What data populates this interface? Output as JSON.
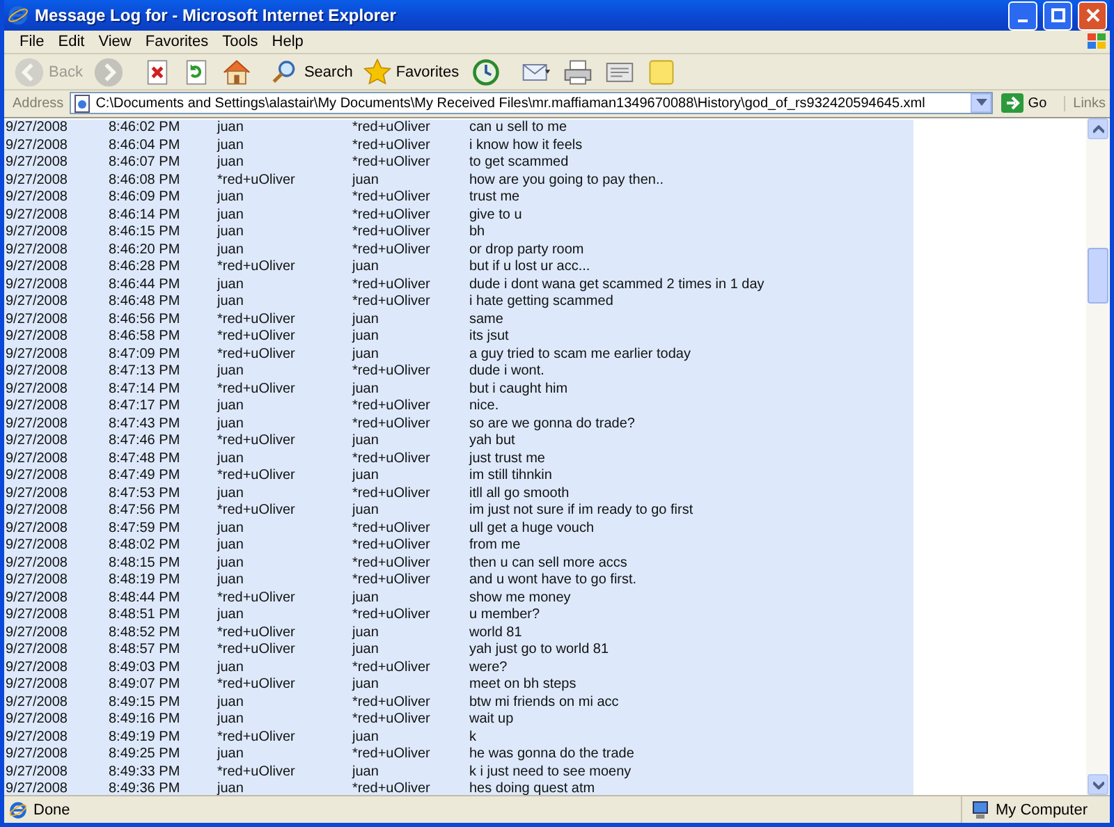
{
  "window": {
    "title": "Message Log for - Microsoft Internet Explorer"
  },
  "menu": [
    "File",
    "Edit",
    "View",
    "Favorites",
    "Tools",
    "Help"
  ],
  "toolbar": [
    {
      "kind": "back",
      "label": "Back",
      "disabled": true
    },
    {
      "kind": "forward",
      "disabled": true
    },
    {
      "kind": "stop",
      "disabled": false
    },
    {
      "kind": "refresh",
      "disabled": false
    },
    {
      "kind": "home",
      "disabled": false
    },
    {
      "kind": "search",
      "label": "Search",
      "disabled": false
    },
    {
      "kind": "favorites",
      "label": "Favorites",
      "disabled": false
    },
    {
      "kind": "history",
      "disabled": false
    },
    {
      "kind": "mail",
      "disabled": false
    },
    {
      "kind": "print",
      "disabled": false
    },
    {
      "kind": "edit",
      "disabled": false
    },
    {
      "kind": "note",
      "disabled": false
    }
  ],
  "address": {
    "label": "Address",
    "value": "C:\\Documents and Settings\\alastair\\My Documents\\My Received Files\\mr.maffiaman1349670088\\History\\god_of_rs932420594645.xml",
    "go": "Go",
    "links": "Links"
  },
  "log": [
    {
      "date": "9/27/2008",
      "time": "8:46:02 PM",
      "from": "juan",
      "to": "*red+uOliver",
      "message": "can u sell to me"
    },
    {
      "date": "9/27/2008",
      "time": "8:46:04 PM",
      "from": "juan",
      "to": "*red+uOliver",
      "message": "i know how it feels"
    },
    {
      "date": "9/27/2008",
      "time": "8:46:07 PM",
      "from": "juan",
      "to": "*red+uOliver",
      "message": "to get scammed"
    },
    {
      "date": "9/27/2008",
      "time": "8:46:08 PM",
      "from": "*red+uOliver",
      "to": "juan",
      "message": "how are you going to pay then.."
    },
    {
      "date": "9/27/2008",
      "time": "8:46:09 PM",
      "from": "juan",
      "to": "*red+uOliver",
      "message": "trust me"
    },
    {
      "date": "9/27/2008",
      "time": "8:46:14 PM",
      "from": "juan",
      "to": "*red+uOliver",
      "message": "give to u"
    },
    {
      "date": "9/27/2008",
      "time": "8:46:15 PM",
      "from": "juan",
      "to": "*red+uOliver",
      "message": "bh"
    },
    {
      "date": "9/27/2008",
      "time": "8:46:20 PM",
      "from": "juan",
      "to": "*red+uOliver",
      "message": "or drop party room"
    },
    {
      "date": "9/27/2008",
      "time": "8:46:28 PM",
      "from": "*red+uOliver",
      "to": "juan",
      "message": "but if u lost ur acc..."
    },
    {
      "date": "9/27/2008",
      "time": "8:46:44 PM",
      "from": "juan",
      "to": "*red+uOliver",
      "message": "dude i dont wana get scammed 2 times in 1 day"
    },
    {
      "date": "9/27/2008",
      "time": "8:46:48 PM",
      "from": "juan",
      "to": "*red+uOliver",
      "message": "i hate getting scammed"
    },
    {
      "date": "9/27/2008",
      "time": "8:46:56 PM",
      "from": "*red+uOliver",
      "to": "juan",
      "message": "same"
    },
    {
      "date": "9/27/2008",
      "time": "8:46:58 PM",
      "from": "*red+uOliver",
      "to": "juan",
      "message": "its jsut"
    },
    {
      "date": "9/27/2008",
      "time": "8:47:09 PM",
      "from": "*red+uOliver",
      "to": "juan",
      "message": "a guy tried to scam me earlier today"
    },
    {
      "date": "9/27/2008",
      "time": "8:47:13 PM",
      "from": "juan",
      "to": "*red+uOliver",
      "message": "dude i wont."
    },
    {
      "date": "9/27/2008",
      "time": "8:47:14 PM",
      "from": "*red+uOliver",
      "to": "juan",
      "message": "but i caught him"
    },
    {
      "date": "9/27/2008",
      "time": "8:47:17 PM",
      "from": "juan",
      "to": "*red+uOliver",
      "message": "nice."
    },
    {
      "date": "9/27/2008",
      "time": "8:47:43 PM",
      "from": "juan",
      "to": "*red+uOliver",
      "message": "so are we gonna do trade?"
    },
    {
      "date": "9/27/2008",
      "time": "8:47:46 PM",
      "from": "*red+uOliver",
      "to": "juan",
      "message": "yah but"
    },
    {
      "date": "9/27/2008",
      "time": "8:47:48 PM",
      "from": "juan",
      "to": "*red+uOliver",
      "message": "just trust me"
    },
    {
      "date": "9/27/2008",
      "time": "8:47:49 PM",
      "from": "*red+uOliver",
      "to": "juan",
      "message": "im still tihnkin"
    },
    {
      "date": "9/27/2008",
      "time": "8:47:53 PM",
      "from": "juan",
      "to": "*red+uOliver",
      "message": "itll all go smooth"
    },
    {
      "date": "9/27/2008",
      "time": "8:47:56 PM",
      "from": "*red+uOliver",
      "to": "juan",
      "message": "im just not sure if im ready to go first"
    },
    {
      "date": "9/27/2008",
      "time": "8:47:59 PM",
      "from": "juan",
      "to": "*red+uOliver",
      "message": "ull get a huge vouch"
    },
    {
      "date": "9/27/2008",
      "time": "8:48:02 PM",
      "from": "juan",
      "to": "*red+uOliver",
      "message": "from me"
    },
    {
      "date": "9/27/2008",
      "time": "8:48:15 PM",
      "from": "juan",
      "to": "*red+uOliver",
      "message": "then u can sell more accs"
    },
    {
      "date": "9/27/2008",
      "time": "8:48:19 PM",
      "from": "juan",
      "to": "*red+uOliver",
      "message": "and u wont have to go first."
    },
    {
      "date": "9/27/2008",
      "time": "8:48:44 PM",
      "from": "*red+uOliver",
      "to": "juan",
      "message": "show me money"
    },
    {
      "date": "9/27/2008",
      "time": "8:48:51 PM",
      "from": "juan",
      "to": "*red+uOliver",
      "message": "u member?"
    },
    {
      "date": "9/27/2008",
      "time": "8:48:52 PM",
      "from": "*red+uOliver",
      "to": "juan",
      "message": "world 81"
    },
    {
      "date": "9/27/2008",
      "time": "8:48:57 PM",
      "from": "*red+uOliver",
      "to": "juan",
      "message": "yah just go to world 81"
    },
    {
      "date": "9/27/2008",
      "time": "8:49:03 PM",
      "from": "juan",
      "to": "*red+uOliver",
      "message": "were?"
    },
    {
      "date": "9/27/2008",
      "time": "8:49:07 PM",
      "from": "*red+uOliver",
      "to": "juan",
      "message": "meet on bh steps"
    },
    {
      "date": "9/27/2008",
      "time": "8:49:15 PM",
      "from": "juan",
      "to": "*red+uOliver",
      "message": "btw mi friends on mi acc"
    },
    {
      "date": "9/27/2008",
      "time": "8:49:16 PM",
      "from": "juan",
      "to": "*red+uOliver",
      "message": "wait up"
    },
    {
      "date": "9/27/2008",
      "time": "8:49:19 PM",
      "from": "*red+uOliver",
      "to": "juan",
      "message": "k"
    },
    {
      "date": "9/27/2008",
      "time": "8:49:25 PM",
      "from": "juan",
      "to": "*red+uOliver",
      "message": "he was gonna do the trade"
    },
    {
      "date": "9/27/2008",
      "time": "8:49:33 PM",
      "from": "*red+uOliver",
      "to": "juan",
      "message": "k i just need to see moeny"
    },
    {
      "date": "9/27/2008",
      "time": "8:49:36 PM",
      "from": "juan",
      "to": "*red+uOliver",
      "message": "hes doing quest atm"
    }
  ],
  "status_bar": {
    "status": "Done",
    "zone": "My Computer"
  }
}
